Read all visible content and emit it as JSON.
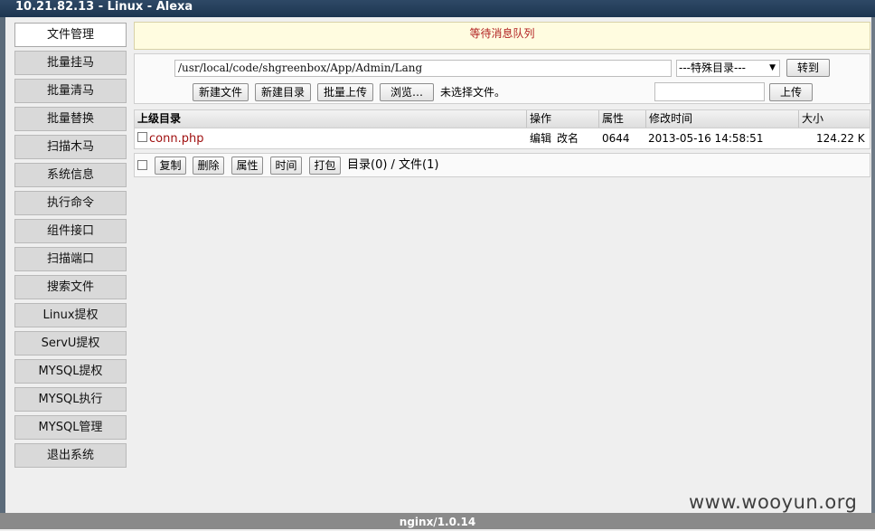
{
  "window": {
    "title": "10.21.82.13 - Linux - Alexa"
  },
  "sidebar": {
    "items": [
      {
        "label": "文件管理",
        "active": true
      },
      {
        "label": "批量挂马"
      },
      {
        "label": "批量清马"
      },
      {
        "label": "批量替换"
      },
      {
        "label": "扫描木马"
      },
      {
        "label": "系统信息"
      },
      {
        "label": "执行命令"
      },
      {
        "label": "组件接口"
      },
      {
        "label": "扫描端口"
      },
      {
        "label": "搜索文件"
      },
      {
        "label": "Linux提权"
      },
      {
        "label": "ServU提权"
      },
      {
        "label": "MYSQL提权"
      },
      {
        "label": "MYSQL执行"
      },
      {
        "label": "MYSQL管理"
      },
      {
        "label": "退出系统"
      }
    ]
  },
  "notice": {
    "text": "等待消息队列"
  },
  "toolbar": {
    "path_value": "/usr/local/code/shgreenbox/App/Admin/Lang",
    "special_dir_selected": "---特殊目录---",
    "goto_label": "转到",
    "new_file_label": "新建文件",
    "new_dir_label": "新建目录",
    "batch_upload_label": "批量上传",
    "browse_label": "浏览…",
    "no_file_text": "未选择文件。",
    "upload_label": "上传"
  },
  "table": {
    "headers": {
      "parent": "上级目录",
      "ops": "操作",
      "perm": "属性",
      "mtime": "修改时间",
      "size": "大小"
    },
    "rows": [
      {
        "name": "conn.php",
        "edit": "编辑",
        "rename": "改名",
        "perm": "0644",
        "mtime": "2013-05-16 14:58:51",
        "size": "124.22 K"
      }
    ]
  },
  "actions": {
    "copy": "复制",
    "delete": "删除",
    "attr": "属性",
    "time": "时间",
    "pack": "打包",
    "summary": "目录(0) / 文件(1)"
  },
  "watermark": "www.wooyun.org",
  "footer": {
    "server": "nginx/1.0.14"
  }
}
